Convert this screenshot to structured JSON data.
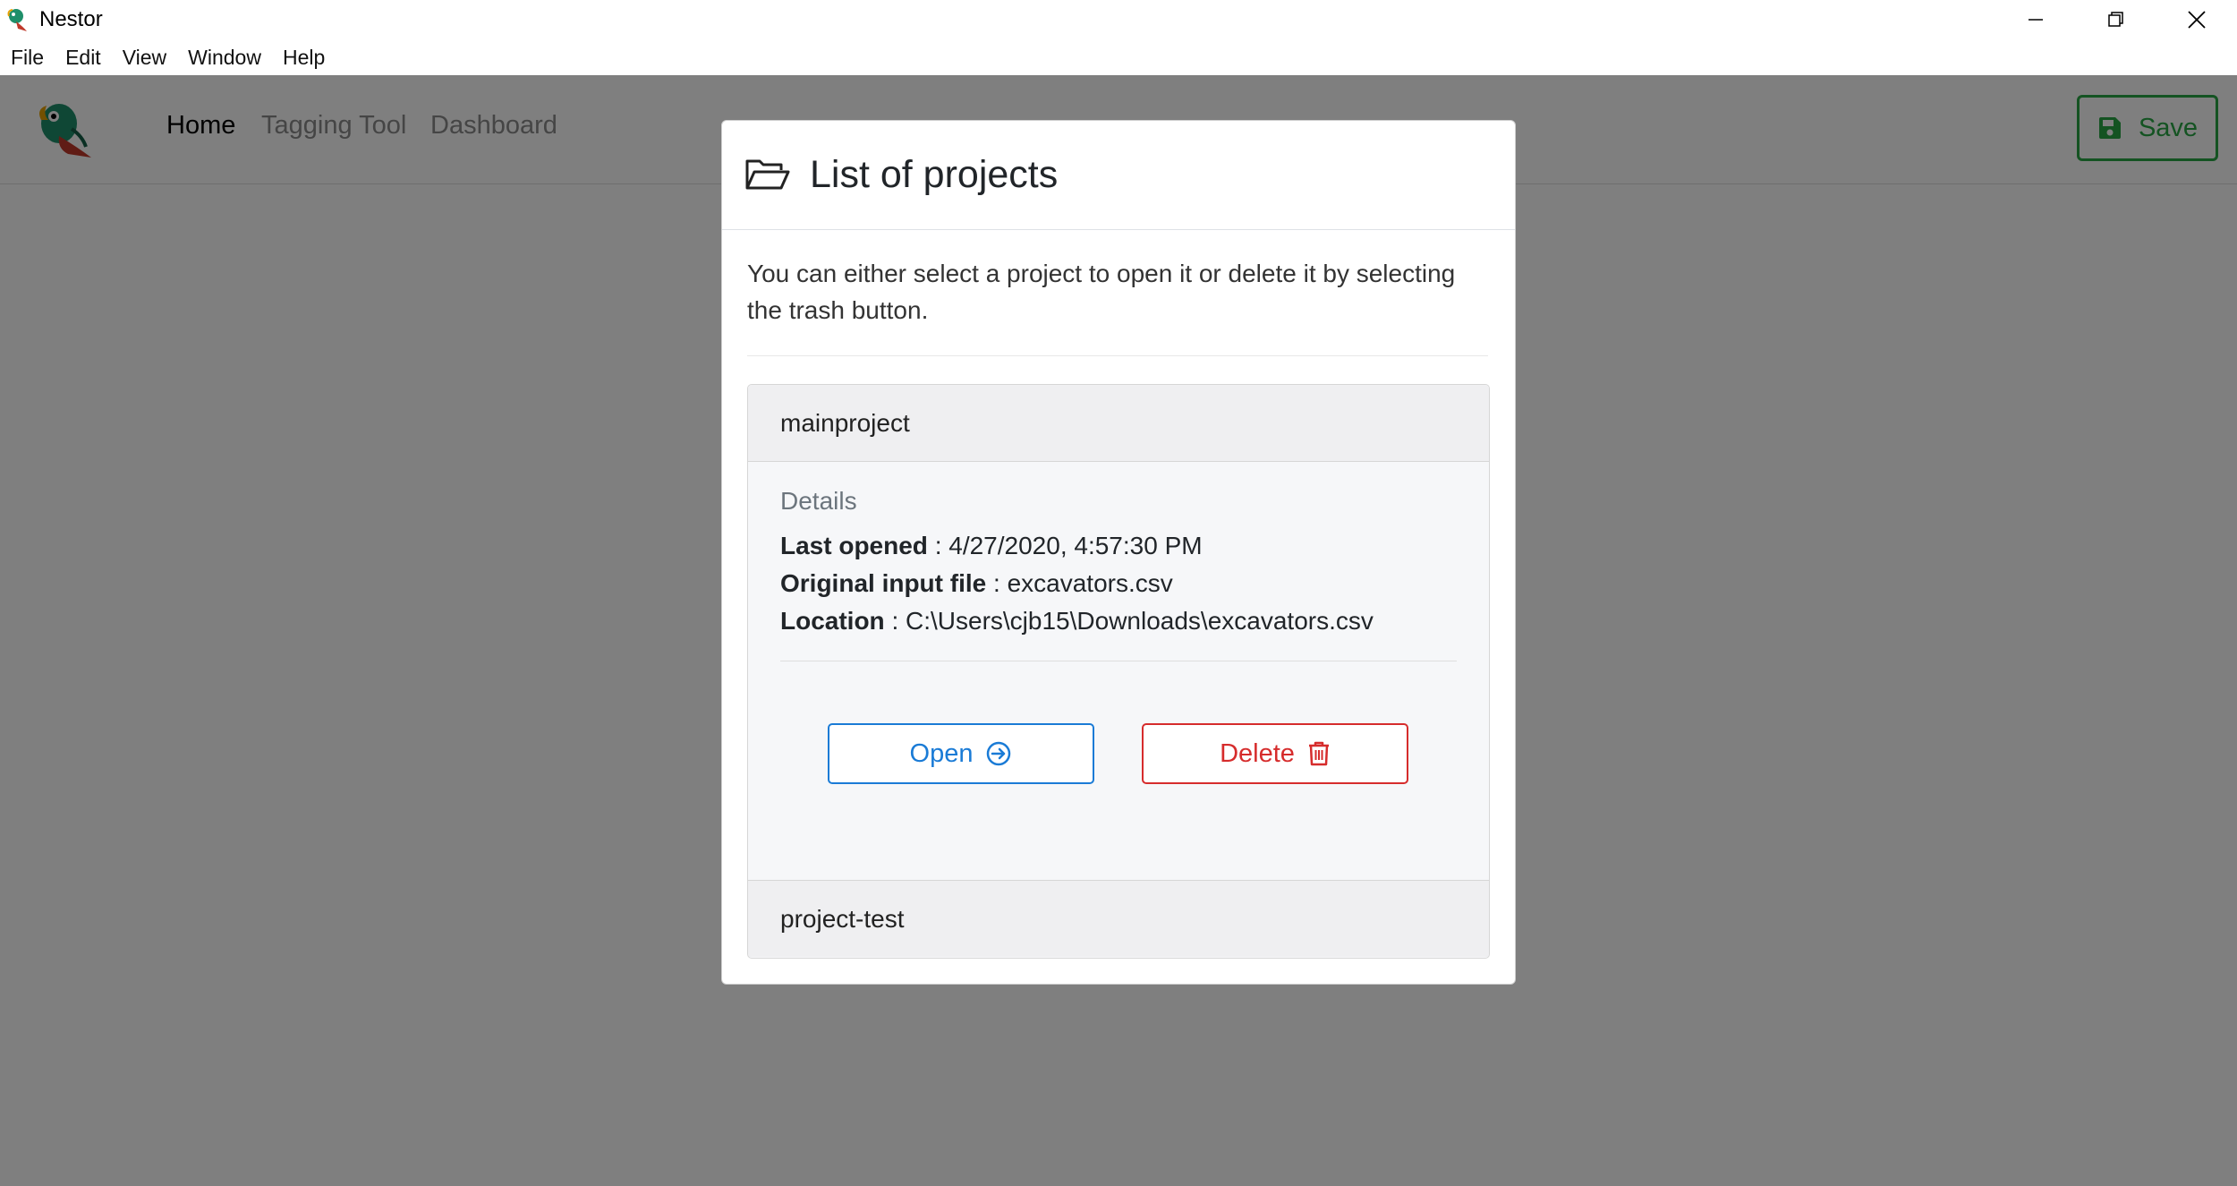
{
  "window": {
    "title": "Nestor"
  },
  "menu": {
    "items": [
      "File",
      "Edit",
      "View",
      "Window",
      "Help"
    ]
  },
  "navbar": {
    "links": [
      "Home",
      "Tagging Tool",
      "Dashboard"
    ],
    "active": "Home",
    "save_label": "Save"
  },
  "modal": {
    "title": "List of projects",
    "intro": "You can either select a project to open it or delete it by selecting the trash button.",
    "projects": [
      {
        "name": "mainproject",
        "details_label": "Details",
        "last_opened_label": "Last opened",
        "last_opened": " : 4/27/2020, 4:57:30 PM",
        "input_file_label": "Original input file",
        "input_file": " : excavators.csv",
        "location_label": "Location",
        "location": " : C:\\Users\\cjb15\\Downloads\\excavators.csv",
        "open_label": "Open",
        "delete_label": "Delete"
      },
      {
        "name": "project-test"
      }
    ]
  },
  "colors": {
    "save": "#28a745",
    "open": "#1a7bd6",
    "delete": "#d62c2c",
    "backdrop": "rgba(0,0,0,0.5)"
  },
  "icons": [
    "parrot-logo-icon",
    "minimize-icon",
    "restore-icon",
    "close-icon",
    "floppy-disk-icon",
    "folder-open-icon",
    "arrow-right-circle-icon",
    "trash-icon"
  ]
}
